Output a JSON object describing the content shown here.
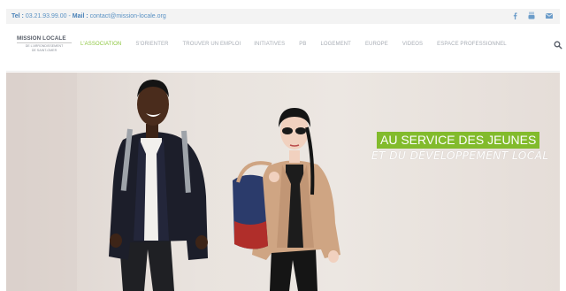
{
  "topbar": {
    "tel_label": "Tel :",
    "tel_value": "03.21.93.99.00",
    "separator": "-",
    "mail_label": "Mail :",
    "mail_value": "contact@mission-locale.org",
    "social_icons": [
      "facebook-icon",
      "youtube-icon",
      "email-icon"
    ]
  },
  "logo": {
    "title": "MISSION LOCALE",
    "subtitle_1": "DE L'ARRONDISSEMENT",
    "subtitle_2": "DE SAINT-OMER"
  },
  "menu": {
    "items": [
      {
        "label": "L'ASSOCIATION",
        "active": true
      },
      {
        "label": "S'ORIENTER",
        "active": false
      },
      {
        "label": "TROUVER UN EMPLOI",
        "active": false
      },
      {
        "label": "INITIATIVES",
        "active": false
      },
      {
        "label": "PB",
        "active": false
      },
      {
        "label": "LOGEMENT",
        "active": false
      },
      {
        "label": "EUROPE",
        "active": false
      },
      {
        "label": "VIDEOS",
        "active": false
      },
      {
        "label": "ESPACE PROFESSIONNEL",
        "active": false
      }
    ]
  },
  "hero": {
    "tagline_1": "AU SERVICE DES JEUNES",
    "tagline_2": "ET DU DÉVELOPPEMENT LOCAL"
  },
  "colors": {
    "accent": "#8dc63f",
    "link": "#5a92c4",
    "tag_bg": "#82bb2c"
  }
}
